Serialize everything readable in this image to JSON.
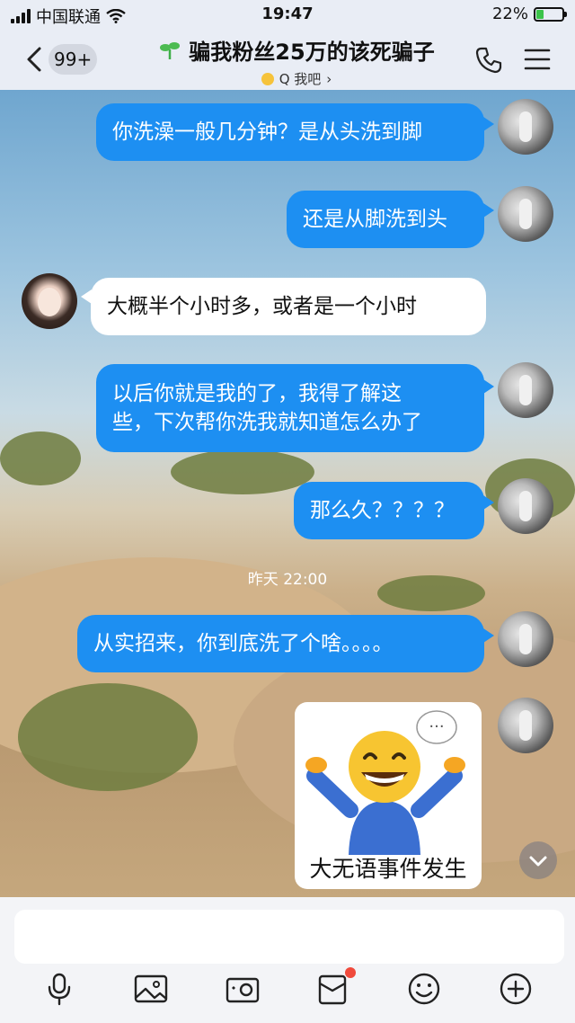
{
  "statusbar": {
    "carrier": "中国联通",
    "time": "19:47",
    "battery": "22%"
  },
  "header": {
    "back_badge": "99+",
    "title": "骗我粉丝25万的该死骗子",
    "subtitle": "Q 我吧",
    "subtitle_chevron": "›"
  },
  "messages": [
    {
      "from": "me",
      "text": "你洗澡一般几分钟？是从头洗到脚"
    },
    {
      "from": "me",
      "text": "还是从脚洗到头"
    },
    {
      "from": "them",
      "text": "大概半个小时多，或者是一个小时"
    },
    {
      "from": "me",
      "lines": [
        "以后你就是我的了，我得了解这",
        "些，下次帮你洗我就知道怎么办了"
      ]
    },
    {
      "from": "me",
      "text": "那么久？？？？"
    },
    {
      "from": "me",
      "text": "从实招来，你到底洗了个啥。。。。"
    }
  ],
  "timestamp": "昨天 22:00",
  "sticker": {
    "caption": "大无语事件发生",
    "bubble_glyph": "···"
  },
  "icons": {
    "back": "chevron-left-icon",
    "phone": "phone-icon",
    "menu": "menu-icon",
    "mic": "microphone-icon",
    "image": "image-icon",
    "camera": "camera-icon",
    "redpacket": "red-packet-icon",
    "emoji": "emoji-icon",
    "plus": "plus-icon",
    "scroll": "chevron-down-icon"
  },
  "colors": {
    "my_bubble": "#1d8ff2",
    "their_bubble": "#ffffff",
    "notify_dot": "#f04a3c",
    "header_bg": "#e9edf5"
  }
}
